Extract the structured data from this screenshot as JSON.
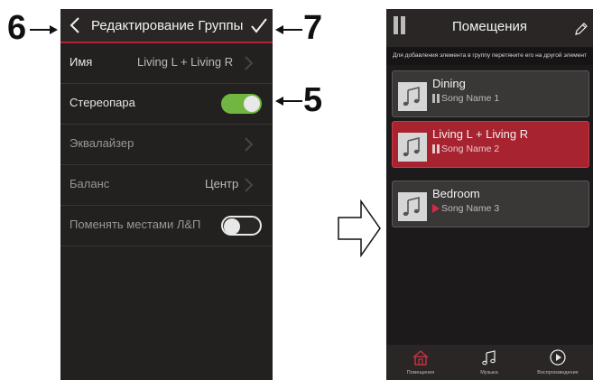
{
  "annotations": {
    "callout_6": "6",
    "callout_7": "7",
    "callout_5": "5"
  },
  "edit_group": {
    "title": "Редактирование Группы",
    "back_icon": "chevron-left-icon",
    "done_icon": "checkmark-icon",
    "rows": {
      "name": {
        "label": "Имя",
        "value": "Living L + Living R"
      },
      "stereo": {
        "label": "Стереопара",
        "toggle": "on"
      },
      "equalizer": {
        "label": "Эквалайзер"
      },
      "balance": {
        "label": "Баланс",
        "value": "Центр"
      },
      "swap": {
        "label": "Поменять местами Л&П",
        "toggle": "off"
      }
    }
  },
  "rooms_screen": {
    "title": "Помещения",
    "hint": "Для добавления элемента в группу перетяните его на другой элемент",
    "rooms": [
      {
        "name": "Dining",
        "song": "Song Name 1",
        "status": "paused"
      },
      {
        "name": "Living L + Living R",
        "song": "Song Name 2",
        "status": "paused",
        "selected": true
      },
      {
        "name": "Bedroom",
        "song": "Song Name 3",
        "status": "playing"
      }
    ],
    "tabs": {
      "rooms": "Помещения",
      "music": "Музыка",
      "playback": "Воспроизведение"
    }
  },
  "colors": {
    "accent": "#b52136",
    "toggle_on": "#71b641",
    "selected_room": "#a7232f",
    "play_indicator": "#d6294a"
  }
}
